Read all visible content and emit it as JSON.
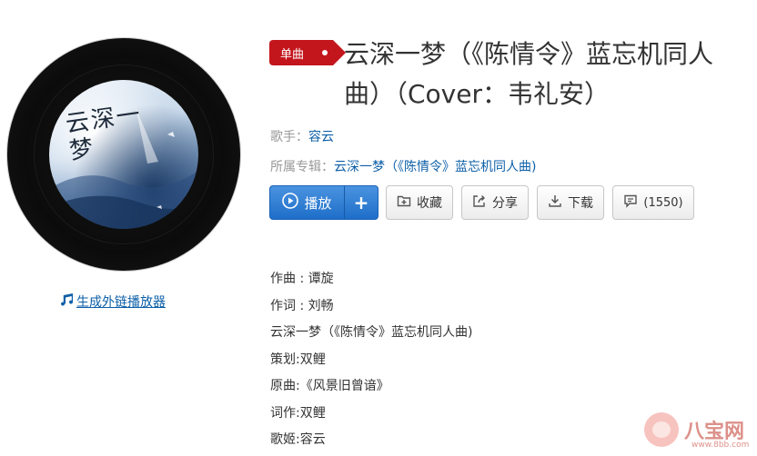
{
  "cover": {
    "art_title": "云深一梦"
  },
  "embed_link": {
    "icon": "music-note-icon",
    "label": "生成外链播放器"
  },
  "song": {
    "badge": "单曲",
    "title": "云深一梦（《陈情令》蓝忘机同人曲）（Cover：韦礼安）"
  },
  "meta": {
    "singer_label": "歌手：",
    "singer": "容云",
    "album_label": "所属专辑：",
    "album": "云深一梦（《陈情令》蓝忘机同人曲)"
  },
  "actions": {
    "play_label": "播放",
    "add_label": "+",
    "collect_label": "收藏",
    "share_label": "分享",
    "download_label": "下载",
    "comment_count": "(1550)"
  },
  "credits": [
    "作曲 : 谭旋",
    "作词 : 刘畅",
    "云深一梦（《陈情令》蓝忘机同人曲)",
    "策划:双鲤",
    "原曲:《风景旧曾谙》",
    "词作:双鲤",
    "歌姬:容云"
  ],
  "watermark": {
    "text": "八宝网",
    "url": "www.8bb.com"
  },
  "colors": {
    "badge_red": "#c3161c",
    "link_blue": "#0c5fa8",
    "play_blue": "#1e6fc9"
  }
}
